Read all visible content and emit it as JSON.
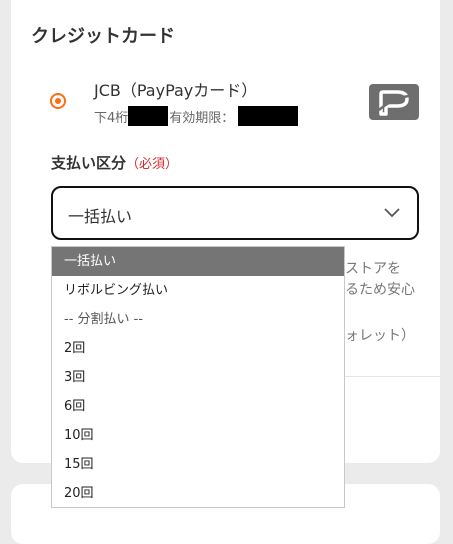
{
  "section": {
    "title": "クレジットカード"
  },
  "card": {
    "name": "JCB（PayPayカード）",
    "digits_label": "下4桁",
    "expiry_label": "有効期限："
  },
  "installment": {
    "label": "支払い区分",
    "required": "（必須）",
    "selected": "一括払い"
  },
  "background_text": {
    "line1": "ストアを",
    "line2": "るため安心",
    "line3": "ォレット）"
  },
  "dropdown": {
    "options": [
      "一括払い",
      "リボルビング払い",
      "-- 分割払い --",
      "2回",
      "3回",
      "6回",
      "10回",
      "15回",
      "20回"
    ]
  },
  "icons": {
    "logo": "paypay-logo",
    "chevron": "chevron-down-icon"
  },
  "colors": {
    "accent": "#ff6a13",
    "required": "#d32f2f",
    "selected_option_bg": "#757575"
  }
}
